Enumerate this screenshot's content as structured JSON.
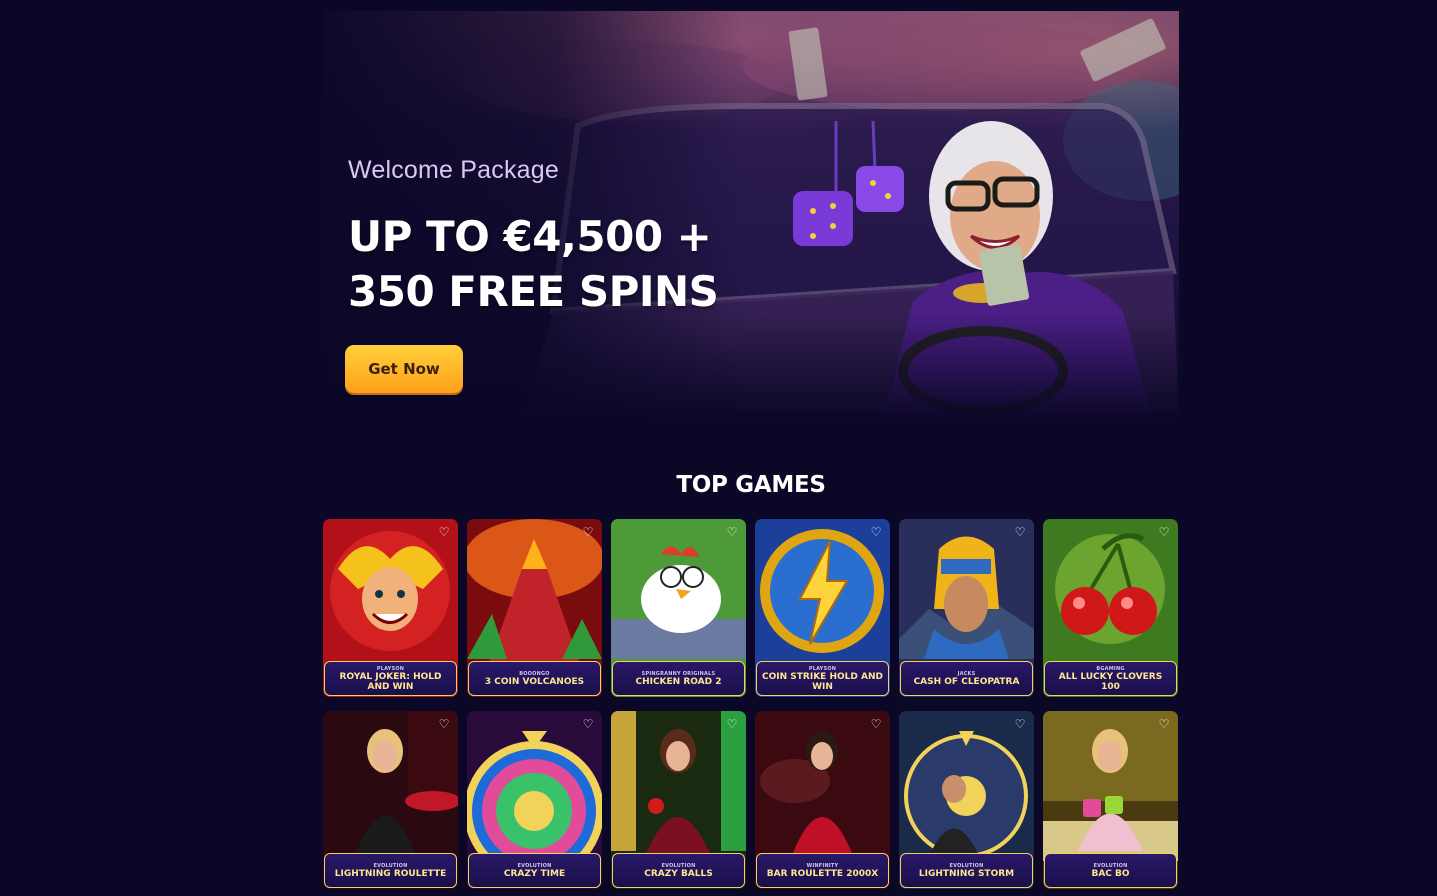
{
  "hero": {
    "eyebrow": "Welcome Package",
    "title_line1": "UP TO €4,500 +",
    "title_line2": "350 FREE SPINS",
    "cta_label": "Get Now"
  },
  "top_games": {
    "title": "TOP GAMES",
    "favorite_icon": "heart-outline-icon",
    "games": [
      {
        "provider": "PLAYSON",
        "name": "ROYAL JOKER: HOLD AND WIN",
        "art": "joker"
      },
      {
        "provider": "BOOONGO",
        "name": "3 COIN VOLCANOES",
        "art": "volcano"
      },
      {
        "provider": "SPINGRANNY ORIGINALS",
        "name": "CHICKEN ROAD 2",
        "art": "chicken"
      },
      {
        "provider": "PLAYSON",
        "name": "COIN STRIKE HOLD AND WIN",
        "art": "lightning"
      },
      {
        "provider": "JACKS",
        "name": "CASH OF CLEOPATRA",
        "art": "cleopatra"
      },
      {
        "provider": "BGAMING",
        "name": "ALL LUCKY CLOVERS 100",
        "art": "cherries"
      },
      {
        "provider": "EVOLUTION",
        "name": "LIGHTNING ROULETTE",
        "art": "host-red"
      },
      {
        "provider": "EVOLUTION",
        "name": "CRAZY TIME",
        "art": "wheel"
      },
      {
        "provider": "EVOLUTION",
        "name": "CRAZY BALLS",
        "art": "host-green"
      },
      {
        "provider": "WINFINITY",
        "name": "BAR ROULETTE 2000X",
        "art": "host-crimson"
      },
      {
        "provider": "EVOLUTION",
        "name": "LIGHTNING STORM",
        "art": "storm"
      },
      {
        "provider": "EVOLUTION",
        "name": "BAC BO",
        "art": "bacbo"
      }
    ]
  },
  "colors": {
    "background": "#0b0726",
    "cta_gradient_top": "#ffcf3a",
    "cta_gradient_bottom": "#ffa11a",
    "card_border": "#f2d35a",
    "game_name": "#ffe690"
  }
}
